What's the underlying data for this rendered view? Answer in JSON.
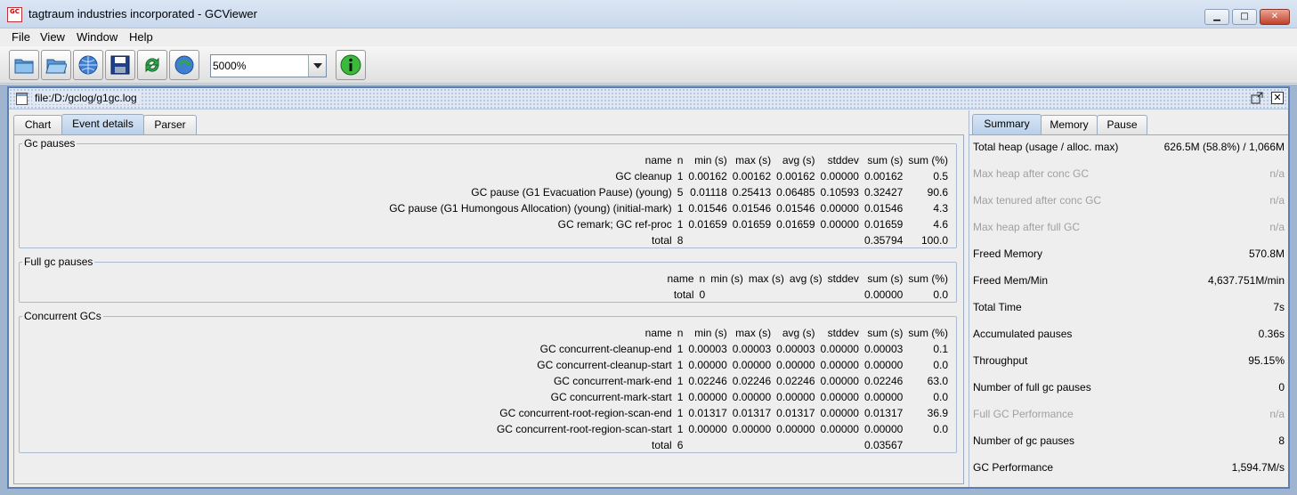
{
  "window": {
    "title": "tagtraum industries incorporated - GCViewer",
    "icon_text": "GC"
  },
  "menu": [
    "File",
    "View",
    "Window",
    "Help"
  ],
  "toolbar": {
    "buttons": [
      "open-file-icon",
      "open-folder-icon",
      "open-url-icon",
      "save-icon",
      "refresh-icon",
      "watch-icon",
      "info-icon"
    ],
    "zoom_value": "5000%"
  },
  "document": {
    "title": "file:/D:/gclog/g1gc.log"
  },
  "tabs": [
    "Chart",
    "Event details",
    "Parser"
  ],
  "gc_pauses": {
    "title": "Gc pauses",
    "headers": [
      "name",
      "n",
      "min (s)",
      "max (s)",
      "avg (s)",
      "stddev",
      "sum (s)",
      "sum (%)"
    ],
    "rows": [
      [
        "GC cleanup",
        "1",
        "0.00162",
        "0.00162",
        "0.00162",
        "0.00000",
        "0.00162",
        "0.5"
      ],
      [
        "GC pause (G1 Evacuation Pause) (young)",
        "5",
        "0.01118",
        "0.25413",
        "0.06485",
        "0.10593",
        "0.32427",
        "90.6"
      ],
      [
        "GC pause (G1 Humongous Allocation) (young) (initial-mark)",
        "1",
        "0.01546",
        "0.01546",
        "0.01546",
        "0.00000",
        "0.01546",
        "4.3"
      ],
      [
        "GC remark; GC ref-proc",
        "1",
        "0.01659",
        "0.01659",
        "0.01659",
        "0.00000",
        "0.01659",
        "4.6"
      ],
      [
        "total",
        "8",
        "",
        "",
        "",
        "",
        "0.35794",
        "100.0"
      ]
    ]
  },
  "full_gc_pauses": {
    "title": "Full gc pauses",
    "headers": [
      "name",
      "n",
      "min (s)",
      "max (s)",
      "avg (s)",
      "stddev",
      "sum (s)",
      "sum (%)"
    ],
    "rows": [
      [
        "total",
        "0",
        "",
        "",
        "",
        "",
        "0.00000",
        "0.0"
      ]
    ]
  },
  "concurrent_gcs": {
    "title": "Concurrent GCs",
    "headers": [
      "name",
      "n",
      "min (s)",
      "max (s)",
      "avg (s)",
      "stddev",
      "sum (s)",
      "sum (%)"
    ],
    "rows": [
      [
        "GC concurrent-cleanup-end",
        "1",
        "0.00003",
        "0.00003",
        "0.00003",
        "0.00000",
        "0.00003",
        "0.1"
      ],
      [
        "GC concurrent-cleanup-start",
        "1",
        "0.00000",
        "0.00000",
        "0.00000",
        "0.00000",
        "0.00000",
        "0.0"
      ],
      [
        "GC concurrent-mark-end",
        "1",
        "0.02246",
        "0.02246",
        "0.02246",
        "0.00000",
        "0.02246",
        "63.0"
      ],
      [
        "GC concurrent-mark-start",
        "1",
        "0.00000",
        "0.00000",
        "0.00000",
        "0.00000",
        "0.00000",
        "0.0"
      ],
      [
        "GC concurrent-root-region-scan-end",
        "1",
        "0.01317",
        "0.01317",
        "0.01317",
        "0.00000",
        "0.01317",
        "36.9"
      ],
      [
        "GC concurrent-root-region-scan-start",
        "1",
        "0.00000",
        "0.00000",
        "0.00000",
        "0.00000",
        "0.00000",
        "0.0"
      ],
      [
        "total",
        "6",
        "",
        "",
        "",
        "",
        "0.03567",
        ""
      ]
    ]
  },
  "summary_tabs": [
    "Summary",
    "Memory",
    "Pause"
  ],
  "summary": [
    {
      "label": "Total heap (usage / alloc. max)",
      "value": "626.5M (58.8%) / 1,066M",
      "enabled": true
    },
    {
      "label": "Max heap after conc GC",
      "value": "n/a",
      "enabled": false
    },
    {
      "label": "Max tenured after conc GC",
      "value": "n/a",
      "enabled": false
    },
    {
      "label": "Max heap after full GC",
      "value": "n/a",
      "enabled": false
    },
    {
      "label": "Freed Memory",
      "value": "570.8M",
      "enabled": true
    },
    {
      "label": "Freed Mem/Min",
      "value": "4,637.751M/min",
      "enabled": true
    },
    {
      "label": "Total Time",
      "value": "7s",
      "enabled": true
    },
    {
      "label": "Accumulated pauses",
      "value": "0.36s",
      "enabled": true
    },
    {
      "label": "Throughput",
      "value": "95.15%",
      "enabled": true
    },
    {
      "label": "Number of full gc pauses",
      "value": "0",
      "enabled": true
    },
    {
      "label": "Full GC Performance",
      "value": "n/a",
      "enabled": false
    },
    {
      "label": "Number of gc pauses",
      "value": "8",
      "enabled": true
    },
    {
      "label": "GC Performance",
      "value": "1,594.7M/s",
      "enabled": true
    }
  ]
}
